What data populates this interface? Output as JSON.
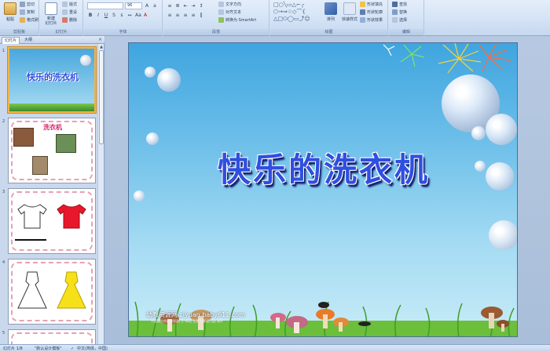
{
  "ribbon": {
    "clipboard": {
      "paste": "粘贴",
      "cut": "剪切",
      "copy": "复制",
      "format_painter": "格式刷",
      "label": "剪贴板"
    },
    "slides": {
      "new_slide": "新建\n幻灯片",
      "layout": "版式",
      "reset": "重设",
      "delete": "删除",
      "label": "幻灯片"
    },
    "font": {
      "size": "96",
      "label": "字体"
    },
    "paragraph": {
      "text_direction": "文字方向",
      "align_text": "对齐文本",
      "smartart": "转换为 SmartArt",
      "label": "段落"
    },
    "drawing": {
      "arrange": "排列",
      "quick_styles": "快速样式",
      "shape_fill": "形状填充",
      "shape_outline": "形状轮廓",
      "shape_effects": "形状效果",
      "label": "绘图"
    },
    "editing": {
      "find": "查找",
      "replace": "替换",
      "select": "选择",
      "label": "编辑"
    }
  },
  "panel": {
    "tab_slides": "幻灯片",
    "tab_outline": "大纲",
    "close": "×",
    "thumbnails": [
      {
        "number": "1",
        "title": "快乐的洗衣机"
      },
      {
        "number": "2",
        "title": "洗衣机"
      },
      {
        "number": "3"
      },
      {
        "number": "4"
      },
      {
        "number": "5"
      }
    ]
  },
  "slide": {
    "title": "快乐的洗衣机",
    "watermark": "幼教资源网 ziyuan.baby611.com",
    "watermark_sub": "中国最大的幼教资源门户网站 免费下载 幼儿园 课件"
  },
  "status": {
    "slide_info": "幻灯片 1/8",
    "theme": "\"默认设计模板\"",
    "language": "中文(简体，中国)"
  },
  "colors": {
    "selected_border": "#f3b447",
    "title_fill": "#2f4fe0",
    "title_shadow": "#16217a"
  }
}
